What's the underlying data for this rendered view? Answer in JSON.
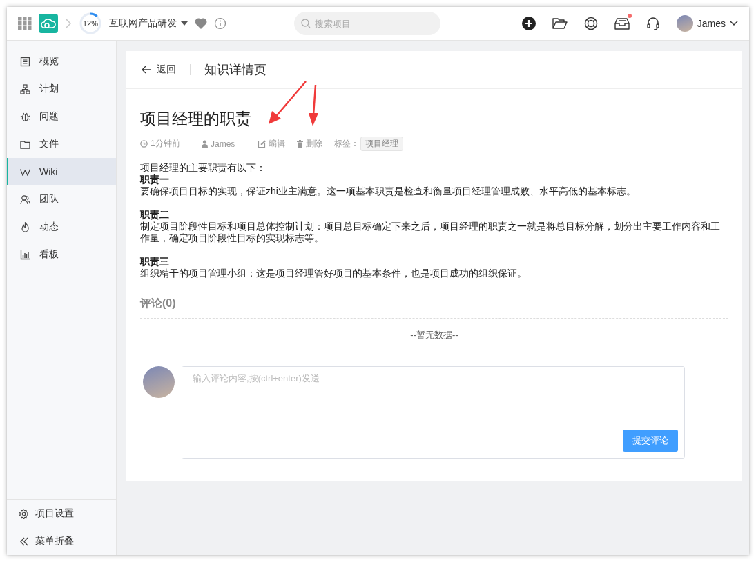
{
  "header": {
    "progress": {
      "level": 0.12,
      "label": "12%"
    },
    "project_name": "互联网产品研发",
    "favorite": true,
    "search": {
      "placeholder": "搜索项目"
    },
    "notification": true,
    "user": "James"
  },
  "sidebar": {
    "items": [
      {
        "label": "概览",
        "selected": false
      },
      {
        "label": "计划",
        "selected": false
      },
      {
        "label": "问题",
        "selected": false
      },
      {
        "label": "文件",
        "selected": false
      },
      {
        "label": "Wiki",
        "selected": true
      },
      {
        "label": "团队",
        "selected": false
      },
      {
        "label": "动态",
        "selected": false
      },
      {
        "label": "看板",
        "selected": false
      }
    ],
    "footer": [
      {
        "label": "项目设置"
      },
      {
        "label": "菜单折叠"
      }
    ]
  },
  "page": {
    "back": "返回",
    "title": "知识详情页"
  },
  "article": {
    "title": "项目经理的职责",
    "time": "1分钟前",
    "author": "James",
    "edit": "编辑",
    "delete": "删除",
    "tags_label": "标签：",
    "tags": [
      "项目经理"
    ],
    "intro": "项目经理的主要职责有以下：",
    "sections": [
      {
        "heading": "职责一",
        "text": "要确保项目目标的实现，保证zhi业主满意。这一项基本职责是检查和衡量项目经理管理成败、水平高低的基本标志。"
      },
      {
        "heading": "职责二",
        "text": "制定项目阶段性目标和项目总体控制计划：项目总目标确定下来之后，项目经理的职责之一就是将总目标分解，划分出主要工作内容和工作量，确定项目阶段性目标的实现标志等。"
      },
      {
        "heading": "职责三",
        "text": "组织精干的项目管理小组：这是项目经理管好项目的基本条件，也是项目成功的组织保证。"
      }
    ]
  },
  "comments": {
    "title": "评论(0)",
    "empty": "--暂无数据--",
    "input": {
      "placeholder": "输入评论内容,按(ctrl+enter)发送"
    },
    "submit": "提交评论"
  }
}
